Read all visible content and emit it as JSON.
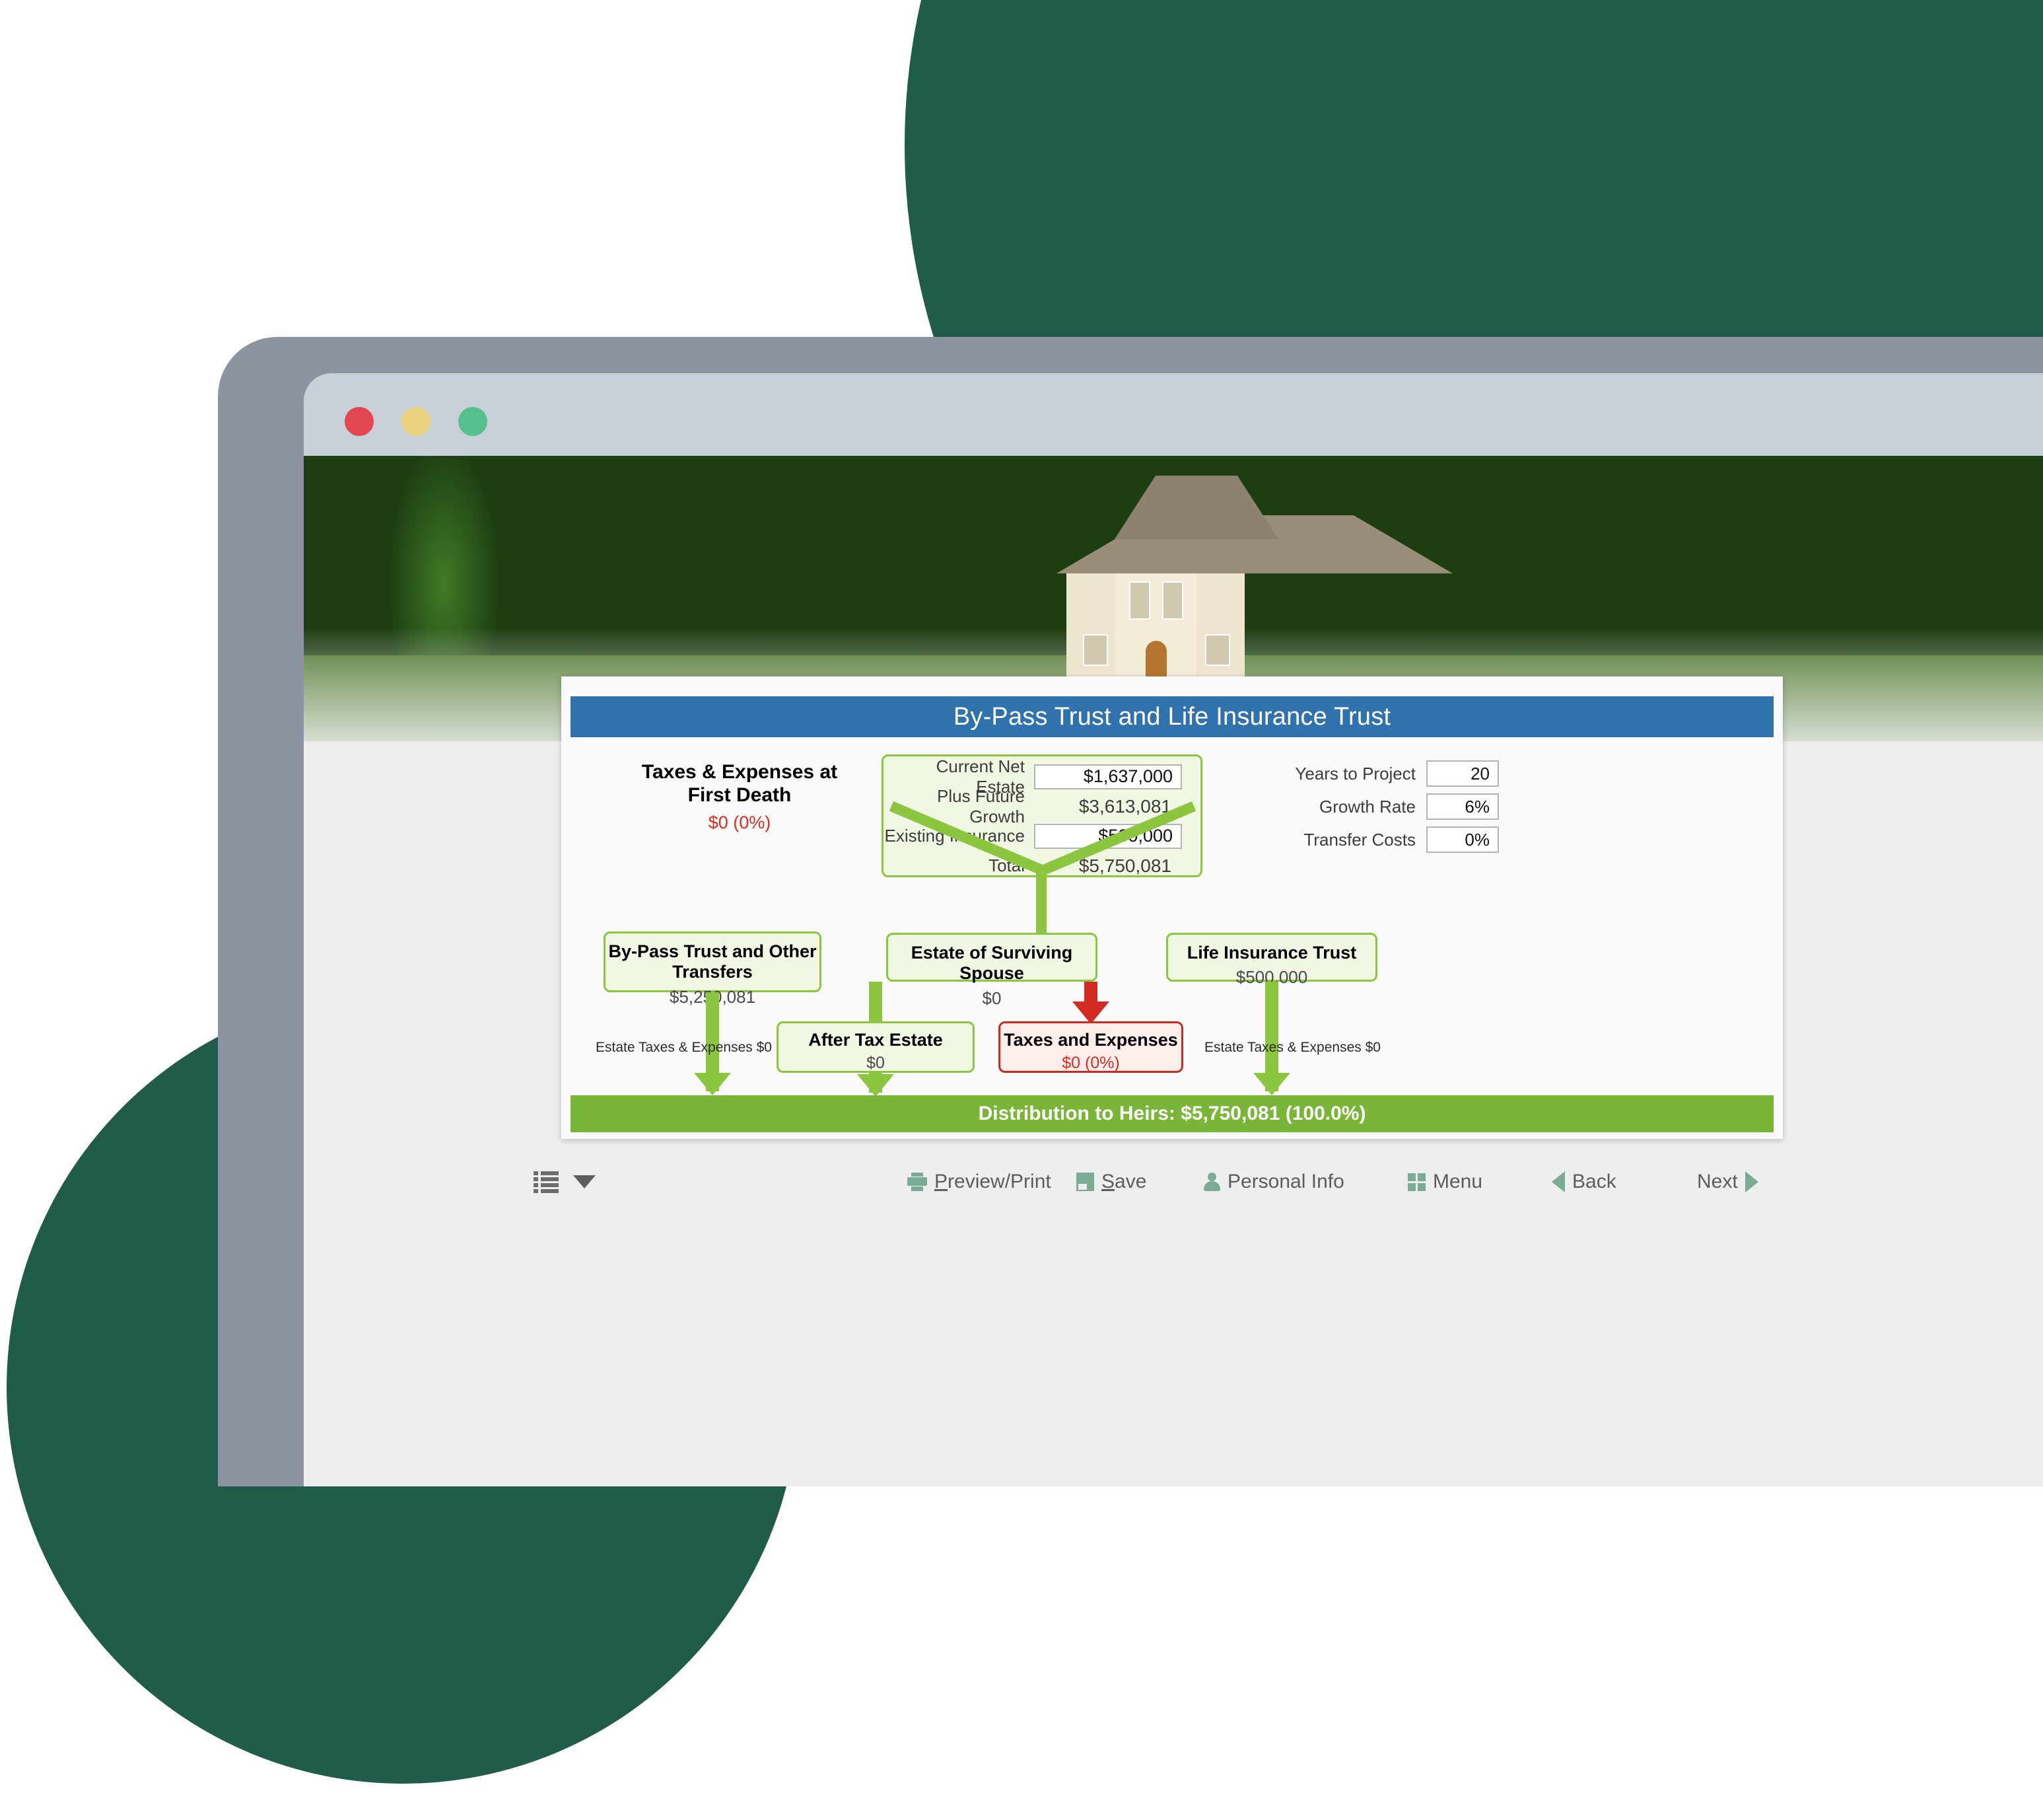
{
  "window": {
    "traffic_lights": [
      {
        "name": "close",
        "color": "#e14651"
      },
      {
        "name": "minimize",
        "color": "#e9d07c"
      },
      {
        "name": "zoom",
        "color": "#55c08e"
      }
    ]
  },
  "diagram": {
    "header_title": "By-Pass Trust and Life Insurance Trust",
    "header_color": "#2f72ad",
    "first_death": {
      "title_line1": "Taxes & Expenses at",
      "title_line2": "First Death",
      "value": "$0 (0%)",
      "value_color": "#e02c1f"
    },
    "estate_box": {
      "rows": [
        {
          "label": "Current Net Estate",
          "value": "$1,637,000",
          "editable": true
        },
        {
          "label": "Plus Future Growth",
          "value": "$3,613,081",
          "editable": false
        },
        {
          "label": "Existing Insurance",
          "value": "$500,000",
          "editable": true
        },
        {
          "label": "Total",
          "value": "$5,750,081",
          "editable": false
        }
      ]
    },
    "assumptions": [
      {
        "label": "Years to Project",
        "value": "20"
      },
      {
        "label": "Growth Rate",
        "value": "6%"
      },
      {
        "label": "Transfer Costs",
        "value": "0%"
      }
    ],
    "tier2": [
      {
        "title": "By-Pass Trust and Other Transfers",
        "value": "$5,250,081"
      },
      {
        "title": "Estate of Surviving Spouse",
        "value": "$0"
      },
      {
        "title": "Life Insurance Trust",
        "value": "$500,000"
      }
    ],
    "tier3": {
      "after_tax": {
        "title": "After Tax Estate",
        "value": "$0"
      },
      "taxes": {
        "title": "Taxes and Expenses",
        "value": "$0 (0%)",
        "border_color": "#cf2a20"
      }
    },
    "side_labels": {
      "left": "Estate Taxes & Expenses $0",
      "right": "Estate Taxes & Expenses $0"
    },
    "distribution_bar": {
      "text": "Distribution to Heirs: $5,750,081 (100.0%)",
      "color": "#79b637"
    },
    "accent_green": "#8cc63f",
    "accent_red": "#d32b22"
  },
  "toolbar": {
    "list_menu_label": "",
    "items": [
      {
        "icon": "printer-icon",
        "label_underlined": "P",
        "label_rest": "review/Print"
      },
      {
        "icon": "save-icon",
        "label_underlined": "S",
        "label_rest": "ave"
      },
      {
        "icon": "person-icon",
        "label_underlined": "",
        "label_rest": "Personal Info"
      },
      {
        "icon": "grid-icon",
        "label_underlined": "",
        "label_rest": "Menu"
      },
      {
        "icon": "triangle-left-icon",
        "label_underlined": "",
        "label_rest": "Back"
      },
      {
        "icon": "triangle-right-icon",
        "label_underlined": "",
        "label_rest": "Next"
      }
    ],
    "icon_color": "#79ab95",
    "text_color": "#5c5c5c"
  },
  "background": {
    "circle_color": "#1f5c4a",
    "frame_color": "#8d93a1",
    "titlebar_color": "#c8d0d8"
  }
}
